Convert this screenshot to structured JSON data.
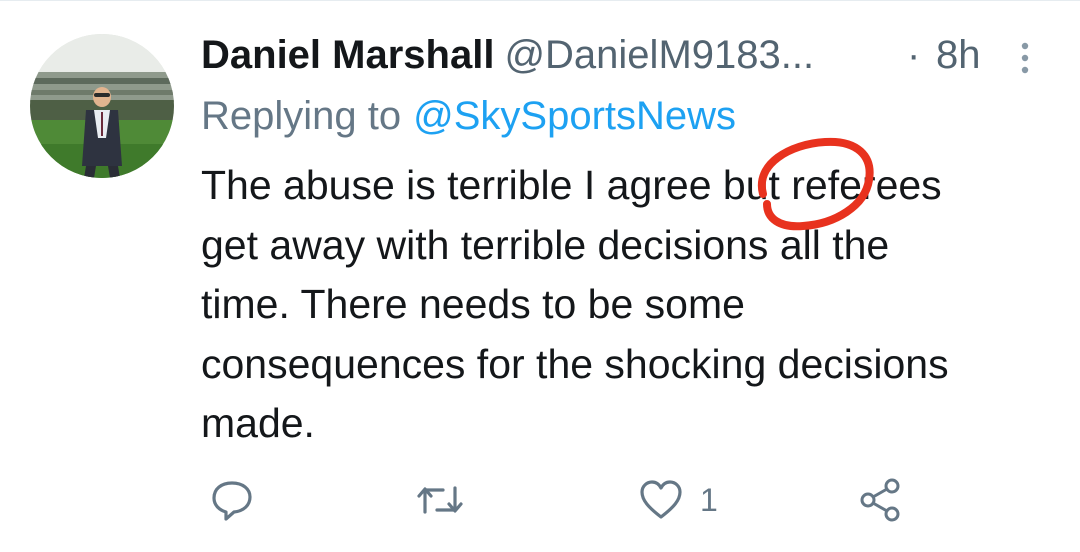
{
  "tweet": {
    "display_name": "Daniel Marshall",
    "handle": "@DanielM9183...",
    "separator": "·",
    "time": "8h",
    "reply_prefix": "Replying to",
    "reply_target": "@SkySportsNews",
    "text_lines": [
      "The abuse is terrible I agree but referees",
      "get away with terrible decisions all the",
      "time. There needs to be some",
      "consequences for the shocking decisions",
      "made."
    ],
    "annotation_color": "#e8321e"
  },
  "actions": {
    "reply_icon": "comment-icon",
    "retweet_icon": "retweet-icon",
    "like_icon": "heart-icon",
    "like_count": "1",
    "share_icon": "share-icon"
  },
  "colors": {
    "text": "#14171a",
    "secondary": "#657786",
    "link": "#1da1f2"
  }
}
